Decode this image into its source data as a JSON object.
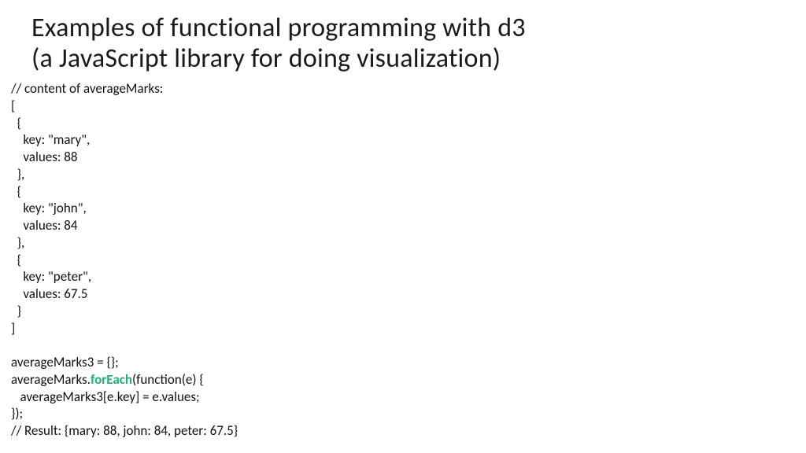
{
  "title_line1": "Examples of functional programming with d3",
  "title_line2": "(a JavaScript library for doing visualization)",
  "code": {
    "l01": "// content of averageMarks:",
    "l02": "[",
    "l03": "  {",
    "l04": "    key: \"mary\",",
    "l05": "    values: 88",
    "l06": "  },",
    "l07": "  {",
    "l08": "    key: \"john\",",
    "l09": "    values: 84",
    "l10": "  },",
    "l11": "  {",
    "l12": "    key: \"peter\",",
    "l13": "    values: 67.5",
    "l14": "  }",
    "l15": "]",
    "l16": "",
    "l17": "averageMarks3 = {};",
    "l18a": "averageMarks.",
    "l18hl": "forEach",
    "l18b": "(function(e) {",
    "l19": "   averageMarks3[e.key] = e.values;",
    "l20": "});",
    "l21": "// Result: {mary: 88, john: 84, peter: 67.5}"
  }
}
